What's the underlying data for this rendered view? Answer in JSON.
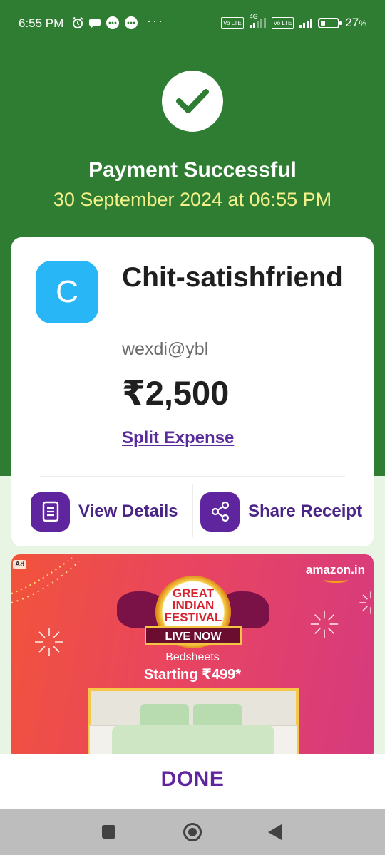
{
  "status_bar": {
    "time": "6:55 PM",
    "battery_text": "27",
    "battery_unit": "%",
    "battery_level": 0.27,
    "network_badge_1": "Vo LTE",
    "network_badge_2": "Vo LTE",
    "network_type": "4G",
    "icons": [
      "alarm-icon",
      "chat-bubble-icon",
      "message-icon",
      "message-icon",
      "more-dots-icon"
    ]
  },
  "header": {
    "title": "Payment Successful",
    "datetime": "30 September 2024 at 06:55 PM",
    "icon": "check-icon"
  },
  "payment_card": {
    "avatar_letter": "C",
    "payee_name": "Chit-satishfriend",
    "upi_id": "wexdi@ybl",
    "amount": "₹2,500",
    "split_expense_label": "Split Expense",
    "actions": [
      {
        "label": "View Details",
        "icon": "receipt-doc-icon"
      },
      {
        "label": "Share Receipt",
        "icon": "share-icon"
      }
    ]
  },
  "ad": {
    "badge": "Ad",
    "brand": "amazon.in",
    "festival_line1": "GREAT",
    "festival_line2": "INDIAN",
    "festival_line3": "FESTIVAL",
    "live_now": "LIVE NOW",
    "product": "Bedsheets",
    "price_label": "Starting ₹499*"
  },
  "footer": {
    "done_label": "DONE"
  },
  "colors": {
    "header_green": "#2e7d32",
    "accent_purple": "#5f259f",
    "date_yellow": "#f4f18a",
    "avatar_blue": "#29b6f6"
  }
}
